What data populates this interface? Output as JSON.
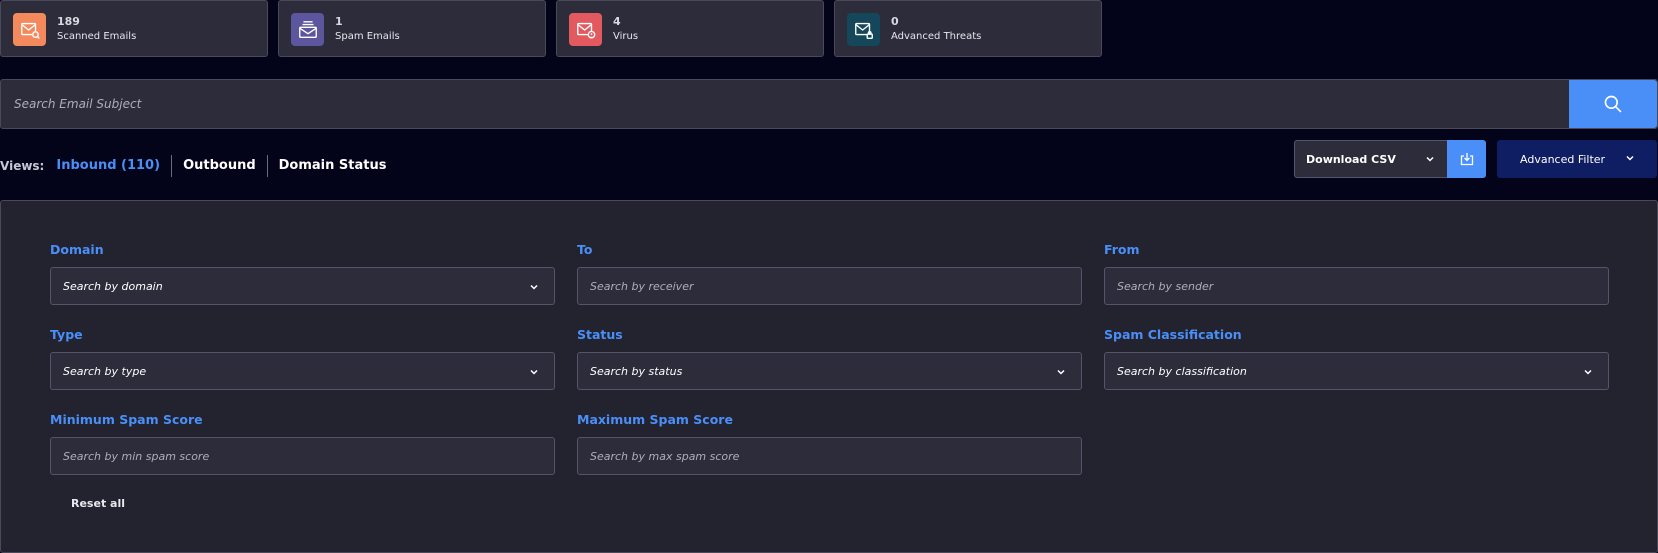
{
  "stats": [
    {
      "value": "189",
      "label": "Scanned Emails",
      "icon": "mail-search-icon",
      "color": "#f4895e"
    },
    {
      "value": "1",
      "label": "Spam Emails",
      "icon": "spam-mail-icon",
      "color": "#5b569e"
    },
    {
      "value": "4",
      "label": "Virus",
      "icon": "virus-mail-icon",
      "color": "#e25a5f"
    },
    {
      "value": "0",
      "label": "Advanced Threats",
      "icon": "threat-mail-icon",
      "color": "#14475a"
    }
  ],
  "search": {
    "placeholder": "Search Email Subject"
  },
  "views": {
    "label": "Views:",
    "tabs": [
      "Inbound (110)",
      "Outbound",
      "Domain Status"
    ]
  },
  "toolbar": {
    "download_label": "Download CSV",
    "advanced_filter_label": "Advanced Filter"
  },
  "filters": {
    "domain": {
      "label": "Domain",
      "placeholder": "Search by domain"
    },
    "to": {
      "label": "To",
      "placeholder": "Search by receiver"
    },
    "from": {
      "label": "From",
      "placeholder": "Search by sender"
    },
    "type": {
      "label": "Type",
      "placeholder": "Search by type"
    },
    "status": {
      "label": "Status",
      "placeholder": "Search by status"
    },
    "classification": {
      "label": "Spam Classification",
      "placeholder": "Search by classification"
    },
    "min_score": {
      "label": "Minimum Spam Score",
      "placeholder": "Search by min spam score"
    },
    "max_score": {
      "label": "Maximum Spam Score",
      "placeholder": "Search by max spam score"
    },
    "reset_label": "Reset all"
  },
  "colors": {
    "accent": "#4a8ff8",
    "background": "#03031a",
    "panel": "#23222f",
    "advanced_button": "#0f1e63"
  }
}
